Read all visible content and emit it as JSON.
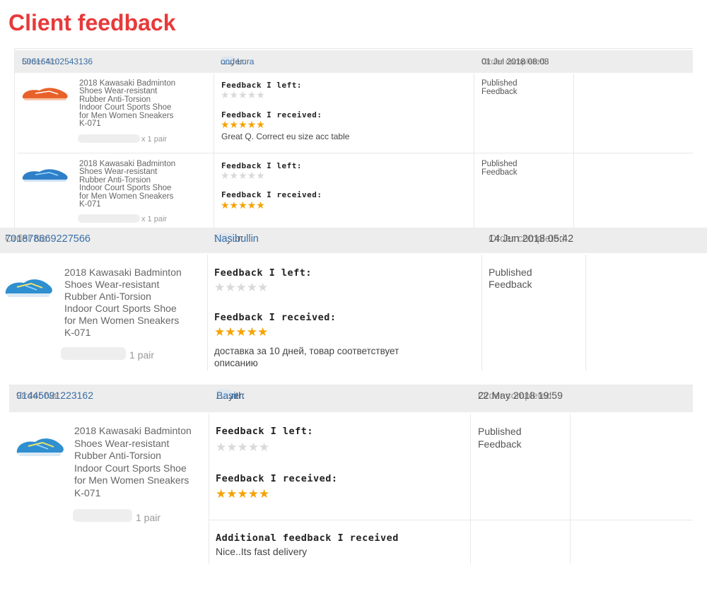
{
  "page_title": "Client feedback",
  "labels": {
    "order_no": "Order No:",
    "buyer": "Buyer:",
    "order_completed": "Order completed",
    "feedback_left": "Feedback I left:",
    "feedback_received": "Feedback I received:",
    "additional_feedback": "Additional feedback I received",
    "published": "Published",
    "feedback": "Feedback",
    "stars": "★★★★★"
  },
  "product_name_lines": [
    "2018 Kawasaki Badminton",
    "Shoes Wear-resistant",
    "Rubber Anti-Torsion",
    "Indoor Court Sports Shoe",
    "for Men Women Sneakers",
    "K-071"
  ],
  "orders": [
    {
      "order_no": "506164102543136",
      "buyer_a": "Ra",
      "buyer_b": "ond Lura",
      "completed": "01 Jul 2018 08:08",
      "items": [
        {
          "qty": "x 1 pair",
          "left_rating": 0,
          "received_rating": 5,
          "received_text": "Great Q. Correct eu size acc table",
          "shoe_color": "#e8612a"
        },
        {
          "qty": "x 1 pair",
          "left_rating": 0,
          "received_rating": 5,
          "received_text": "",
          "shoe_color": "#2f7fc8"
        }
      ]
    },
    {
      "order_no": "701878669227566",
      "buyer_a": "Ti",
      "buyer_b": "Nasibullin",
      "completed": "14 Jun 2018 05:42",
      "items": [
        {
          "qty": "1 pair",
          "left_rating": 0,
          "received_rating": 5,
          "received_text_line1": "доставка за 10 дней, товар соответствует",
          "received_text_line2": "описанию",
          "shoe_color": "#2f8fd0"
        }
      ]
    },
    {
      "order_no": "91445091223162",
      "buyer_a": "Ahm",
      "buyer_b": "Basith",
      "completed": "22 May 2018 19:59",
      "items": [
        {
          "qty": "1 pair",
          "left_rating": 0,
          "received_rating": 5,
          "additional_text": "Nice..Its fast delivery",
          "shoe_color": "#2f8fd0"
        }
      ]
    }
  ]
}
